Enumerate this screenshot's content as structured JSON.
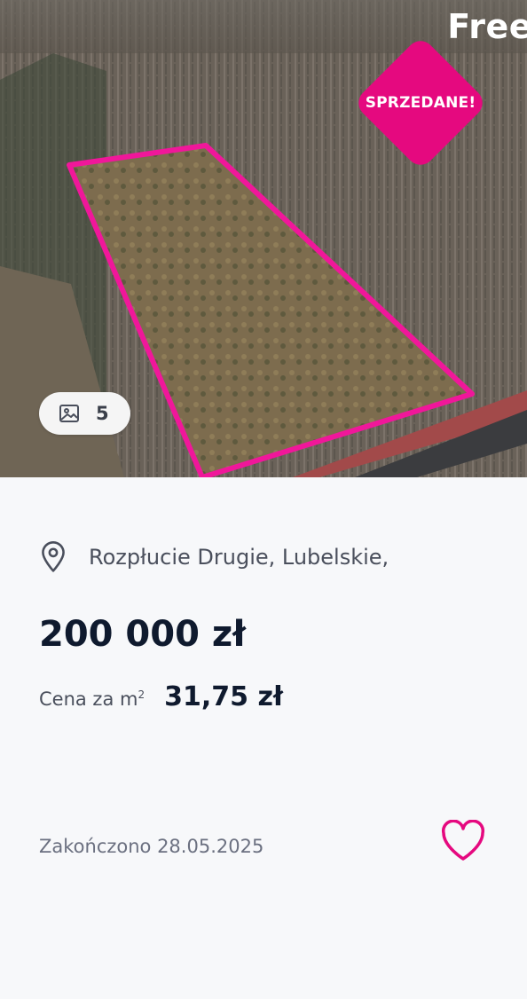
{
  "brand": {
    "text": "Free"
  },
  "badge": {
    "label": "SPRZEDANE!"
  },
  "gallery": {
    "count": "5",
    "icon": "image-icon"
  },
  "listing": {
    "location": "Rozpłucie Drugie, Lubelskie,",
    "price": "200 000 zł",
    "price_per_m2_label": "Cena za m",
    "price_per_m2_sup": "2",
    "price_per_m2_value": "31,75 zł",
    "ended": "Zakończono 28.05.2025"
  },
  "colors": {
    "accent": "#e5097f",
    "price": "#0f1a2e",
    "muted": "#6b7080"
  }
}
